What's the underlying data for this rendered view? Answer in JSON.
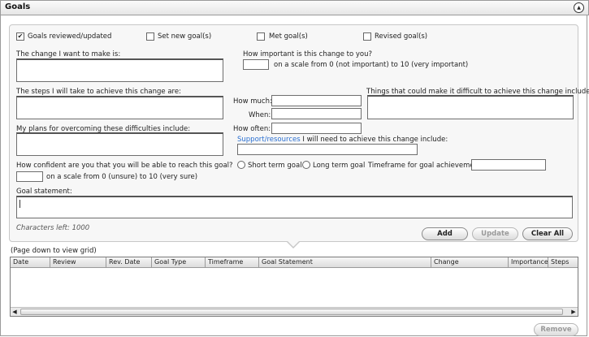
{
  "header": {
    "title": "Goals",
    "collapse_glyph": "▲"
  },
  "checkboxes": [
    {
      "label": "Goals reviewed/updated",
      "checked": true
    },
    {
      "label": "Set new goal(s)",
      "checked": false
    },
    {
      "label": "Met goal(s)",
      "checked": false
    },
    {
      "label": "Revised goal(s)",
      "checked": false
    }
  ],
  "fields": {
    "change_label": "The change I want to make is:",
    "importance_label": "How important is this change to you?",
    "importance_scale": "on a scale from 0 (not important)  to 10 (very important)",
    "steps_label": "The steps I will take to achieve this change are:",
    "how_much_label": "How much:",
    "when_label": "When:",
    "how_often_label": "How often:",
    "difficult_label": "Things that could make it difficult to achieve this change include:",
    "plans_label": "My plans for overcoming these difficulties include:",
    "support_link": "Support/resources",
    "support_rest": " I will need to achieve this change include:",
    "confidence_label": "How confident are you that you will be able to reach this goal?",
    "confidence_scale": "on a scale from 0 (unsure)  to 10 (very sure)",
    "short_term_label": "Short term goal",
    "long_term_label": "Long term goal",
    "timeframe_label": "Timeframe for goal achievement:",
    "statement_label": "Goal statement:",
    "chars_left": "Characters left: 1000"
  },
  "buttons": {
    "add": "Add",
    "update": "Update",
    "clear_all": "Clear All",
    "remove": "Remove"
  },
  "grid": {
    "hint": "(Page down to view grid)",
    "columns": [
      "Date",
      "Review",
      "Rev. Date",
      "Goal Type",
      "Timeframe",
      "Goal Statement",
      "Change",
      "Importance",
      "Steps"
    ]
  },
  "icons": {
    "collapse": "chevron-up-circle-icon",
    "scroll_left": "scroll-left-arrow-icon",
    "scroll_right": "scroll-right-arrow-icon",
    "checkmark": "checkmark-icon"
  }
}
